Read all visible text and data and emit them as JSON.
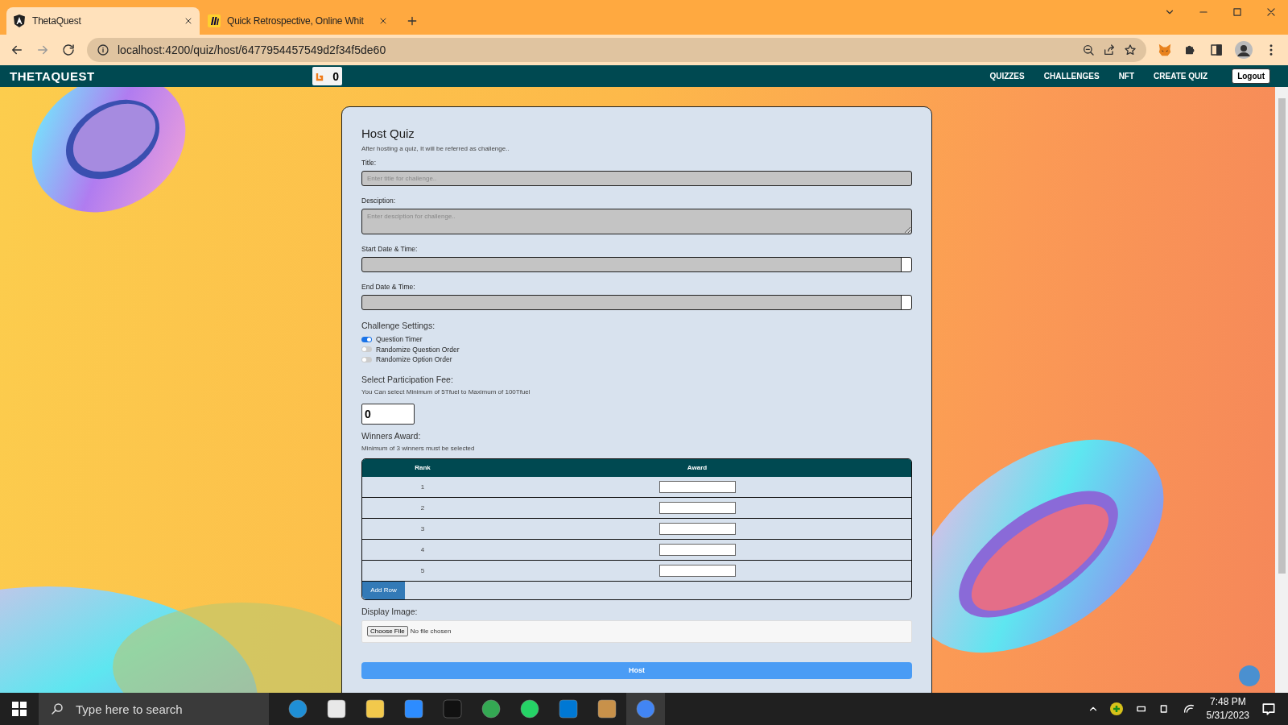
{
  "browser": {
    "tabs": [
      {
        "title": "ThetaQuest",
        "selected": true,
        "kind": "angular"
      },
      {
        "title": "Quick Retrospective, Online Whit",
        "selected": false,
        "kind": "miro"
      }
    ],
    "address": "localhost:4200/quiz/host/6477954457549d2f34f5de60"
  },
  "navbar": {
    "brand": "THETAQUEST",
    "token_count": "0",
    "links": [
      "QUIZZES",
      "CHALLENGES",
      "NFT",
      "CREATE QUIZ"
    ],
    "logout": "Logout"
  },
  "form": {
    "heading": "Host Quiz",
    "subtitle": "After hosting a quiz, It will be referred as challenge..",
    "fields": [
      {
        "label": "Title:",
        "kind": "text",
        "placeholder": "Enter title for challenge.."
      },
      {
        "label": "Desciption:",
        "kind": "textarea",
        "placeholder": "Enter desciption for challenge.."
      },
      {
        "label": "Start Date & Time:",
        "kind": "datetime"
      },
      {
        "label": "End Date & Time:",
        "kind": "datetime"
      }
    ],
    "settings_label": "Challenge Settings:",
    "settings": [
      {
        "label": "Question Timer",
        "on": true
      },
      {
        "label": "Randomize Question Order",
        "on": false
      },
      {
        "label": "Randomize Option Order",
        "on": false
      }
    ],
    "fee_label": "Select Participation Fee:",
    "fee_hint": "You Can select Minimum of 5Tfuel to Maximum of 100Tfuel",
    "fee_value": "0",
    "winners_label": "Winners Award:",
    "winners_hint": "Minimum of 3 winners must be selected",
    "table": {
      "columns": [
        "Rank",
        "Award"
      ],
      "rows": [
        "1",
        "2",
        "3",
        "4",
        "5"
      ]
    },
    "add_row": "Add Row",
    "image_label": "Display Image:",
    "choose_file": "Choose File",
    "no_file": "No file chosen",
    "submit": "Host"
  },
  "taskbar": {
    "search_placeholder": "Type here to search",
    "time": "7:48 PM",
    "date": "5/31/2023"
  }
}
